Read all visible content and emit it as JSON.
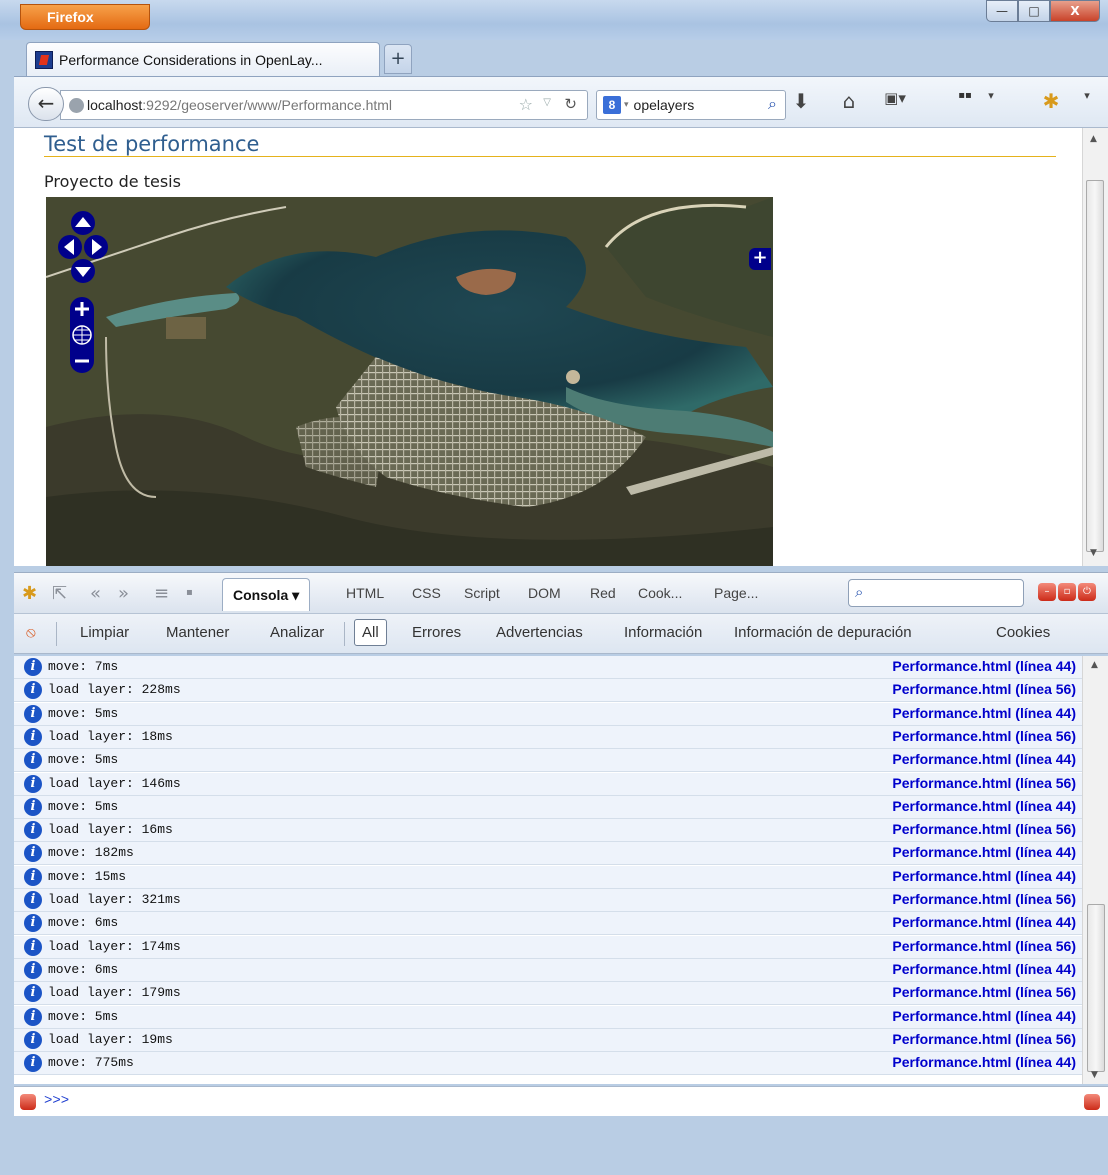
{
  "browser": {
    "menu_button": "Firefox",
    "window_controls": {
      "minimize": "—",
      "maximize": "□",
      "close": "X"
    },
    "tab": {
      "title": "Performance Considerations in OpenLay...",
      "new_tab": "+"
    },
    "url": {
      "host": "localhost",
      "path": ":9292/geoserver/www/Performance.html"
    },
    "search": {
      "engine": "8",
      "value": "opelayers"
    }
  },
  "page": {
    "title": "Test de performance",
    "subtitle": "Proyecto de tesis"
  },
  "firebug": {
    "panel_menu": "Consola ▾",
    "tabs": [
      "HTML",
      "CSS",
      "Script",
      "DOM",
      "Red",
      "Cook...",
      "Page..."
    ],
    "filters": {
      "clear": "Limpiar",
      "persist": "Mantener",
      "profile": "Analizar",
      "all": "All",
      "errors": "Errores",
      "warnings": "Advertencias",
      "info": "Información",
      "debug": "Información de depuración",
      "cookies": "Cookies"
    },
    "log": [
      {
        "msg": "move: 7ms",
        "src": "Performance.html (línea 44)"
      },
      {
        "msg": "load layer: 228ms",
        "src": "Performance.html (línea 56)"
      },
      {
        "msg": "move: 5ms",
        "src": "Performance.html (línea 44)"
      },
      {
        "msg": "load layer: 18ms",
        "src": "Performance.html (línea 56)"
      },
      {
        "msg": "move: 5ms",
        "src": "Performance.html (línea 44)"
      },
      {
        "msg": "load layer: 146ms",
        "src": "Performance.html (línea 56)"
      },
      {
        "msg": "move: 5ms",
        "src": "Performance.html (línea 44)"
      },
      {
        "msg": "load layer: 16ms",
        "src": "Performance.html (línea 56)"
      },
      {
        "msg": "move: 182ms",
        "src": "Performance.html (línea 44)"
      },
      {
        "msg": "move: 15ms",
        "src": "Performance.html (línea 44)"
      },
      {
        "msg": "load layer: 321ms",
        "src": "Performance.html (línea 56)"
      },
      {
        "msg": "move: 6ms",
        "src": "Performance.html (línea 44)"
      },
      {
        "msg": "load layer: 174ms",
        "src": "Performance.html (línea 56)"
      },
      {
        "msg": "move: 6ms",
        "src": "Performance.html (línea 44)"
      },
      {
        "msg": "load layer: 179ms",
        "src": "Performance.html (línea 56)"
      },
      {
        "msg": "move: 5ms",
        "src": "Performance.html (línea 44)"
      },
      {
        "msg": "load layer: 19ms",
        "src": "Performance.html (línea 56)"
      },
      {
        "msg": "move: 775ms",
        "src": "Performance.html (línea 44)"
      }
    ],
    "command_prompt": ">>>"
  },
  "colors": {
    "link": "#0000cc",
    "title": "#2f5e8f",
    "rule": "#e5b21b",
    "map_control": "#00008b"
  }
}
